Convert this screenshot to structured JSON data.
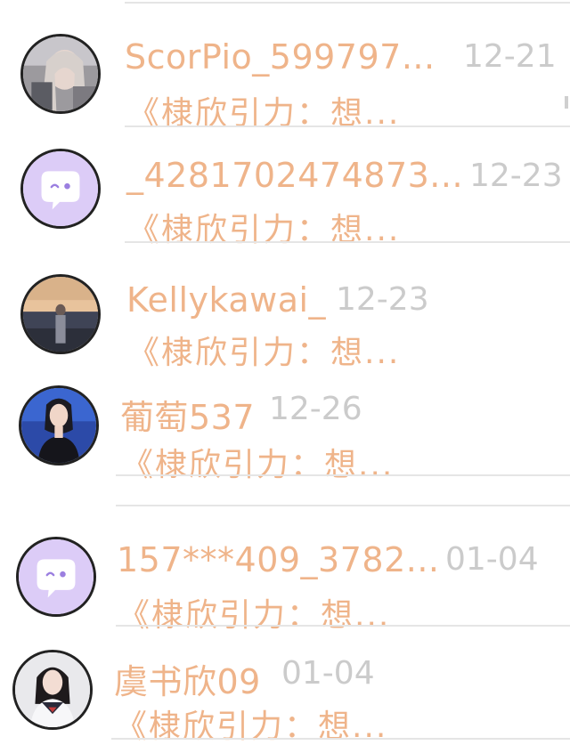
{
  "conversations": [
    {
      "name": "ScorPio_599797...",
      "date": "12-21",
      "preview": "《棣欣引力：想...",
      "avatar_type": "photo-girl-light",
      "avatar_icon": "user-photo"
    },
    {
      "name": "_4281702474873...",
      "date": "12-23",
      "preview": "《棣欣引力：想...",
      "avatar_type": "default",
      "avatar_icon": "chat-bubble-face-icon"
    },
    {
      "name": "Kellykawai_",
      "date": "12-23",
      "preview": "《棣欣引力：想...",
      "avatar_type": "photo-sunset",
      "avatar_icon": "user-photo"
    },
    {
      "name": "葡萄537",
      "date": "12-26",
      "preview": "《棣欣引力：想...",
      "avatar_type": "photo-girl-blue",
      "avatar_icon": "user-photo"
    },
    {
      "name": "157***409_3782...",
      "date": "01-04",
      "preview": "《棣欣引力：想...",
      "avatar_type": "default",
      "avatar_icon": "chat-bubble-face-icon"
    },
    {
      "name": "虞书欣09",
      "date": "01-04",
      "preview": "《棣欣引力：想...",
      "avatar_type": "photo-girl-uniform",
      "avatar_icon": "user-photo"
    }
  ],
  "colors": {
    "accent_text": "#efb48a",
    "date_text": "#cbcbcb",
    "divider": "#e5e5e5",
    "default_avatar_bg": "#dcccf7"
  }
}
